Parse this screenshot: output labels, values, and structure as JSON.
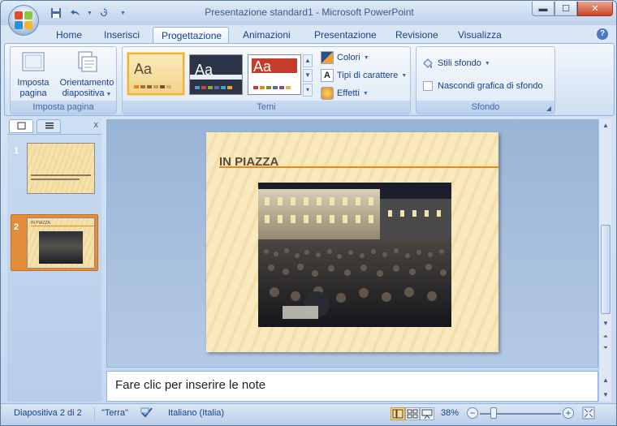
{
  "window": {
    "title": "Presentazione standard1 - Microsoft PowerPoint"
  },
  "qat": {
    "save_icon": "save-icon",
    "undo_icon": "undo-icon",
    "redo_icon": "redo-icon",
    "customize_icon": "chevron-down-icon"
  },
  "tabs": [
    "Home",
    "Inserisci",
    "Progettazione",
    "Animazioni",
    "Presentazione",
    "Revisione",
    "Visualizza"
  ],
  "active_tab": "Progettazione",
  "ribbon": {
    "imposta_pagina_label": "Imposta\npagina",
    "orientamento_label": "Orientamento\ndiapositiva",
    "group_imposta_pagina": "Imposta pagina",
    "group_temi": "Temi",
    "group_sfondo": "Sfondo",
    "theme_aa": "Aa",
    "colori": "Colori",
    "tipi_carattere": "Tipi di carattere",
    "effetti": "Effetti",
    "stili_sfondo": "Stili sfondo",
    "nascondi_grafica": "Nascondi grafica di sfondo"
  },
  "slides": [
    {
      "number": "1"
    },
    {
      "number": "2",
      "title": "IN PIAZZA"
    }
  ],
  "slide": {
    "title": "IN PIAZZA"
  },
  "notes": {
    "placeholder": "Fare clic per inserire le note"
  },
  "status": {
    "slide_info": "Diapositiva 2 di 2",
    "theme": "\"Terra\"",
    "language": "Italiano (Italia)",
    "zoom": "38%"
  },
  "colors": {
    "accent": "#e48a1a",
    "ribbon_blue": "#15428b",
    "selected_thumb": "#e38c3a"
  }
}
